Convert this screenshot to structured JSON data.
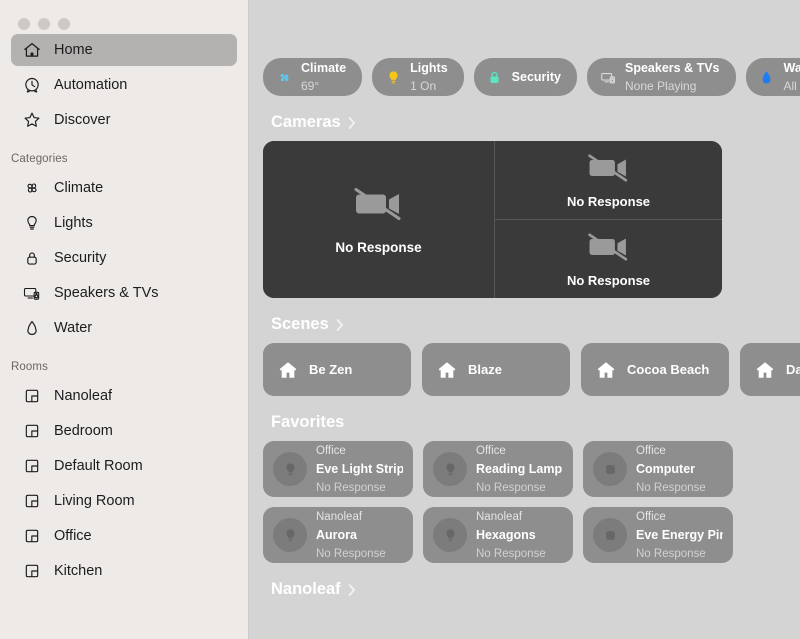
{
  "window": {
    "traffic_lights": [
      "close",
      "minimize",
      "zoom"
    ]
  },
  "sidebar": {
    "nav": [
      {
        "label": "Home",
        "icon": "house-icon",
        "selected": true
      },
      {
        "label": "Automation",
        "icon": "clock-arrow-icon",
        "selected": false
      },
      {
        "label": "Discover",
        "icon": "star-icon",
        "selected": false
      }
    ],
    "categories_header": "Categories",
    "categories": [
      {
        "label": "Climate",
        "icon": "fan-icon"
      },
      {
        "label": "Lights",
        "icon": "lightbulb-icon"
      },
      {
        "label": "Security",
        "icon": "lock-icon"
      },
      {
        "label": "Speakers & TVs",
        "icon": "tv-speaker-icon"
      },
      {
        "label": "Water",
        "icon": "drop-icon"
      }
    ],
    "rooms_header": "Rooms",
    "rooms": [
      {
        "label": "Nanoleaf",
        "icon": "room-icon"
      },
      {
        "label": "Bedroom",
        "icon": "room-icon"
      },
      {
        "label": "Default Room",
        "icon": "room-icon"
      },
      {
        "label": "Living Room",
        "icon": "room-icon"
      },
      {
        "label": "Office",
        "icon": "room-icon"
      },
      {
        "label": "Kitchen",
        "icon": "room-icon"
      }
    ]
  },
  "status_pills": [
    {
      "title": "Climate",
      "subtitle": "69°",
      "icon": "fan-icon",
      "color": "#5ac8f5"
    },
    {
      "title": "Lights",
      "subtitle": "1 On",
      "icon": "lightbulb-icon",
      "color": "#f5c518"
    },
    {
      "title": "Security",
      "subtitle": "",
      "icon": "lock-icon",
      "color": "#5fe3c0"
    },
    {
      "title": "Speakers & TVs",
      "subtitle": "None Playing",
      "icon": "tv-speaker-icon",
      "color": "#d9d9d9"
    },
    {
      "title": "Water",
      "subtitle": "All Off",
      "icon": "drop-icon",
      "color": "#1d7df5"
    }
  ],
  "sections": {
    "cameras": {
      "title": "Cameras",
      "has_chevron": true
    },
    "scenes": {
      "title": "Scenes",
      "has_chevron": true
    },
    "favorites": {
      "title": "Favorites",
      "has_chevron": false
    },
    "nanoleaf": {
      "title": "Nanoleaf",
      "has_chevron": true
    }
  },
  "cameras": {
    "large": {
      "status": "No Response",
      "icon": "video-off-icon"
    },
    "small": [
      {
        "status": "No Response",
        "icon": "video-off-icon"
      },
      {
        "status": "No Response",
        "icon": "video-off-icon"
      }
    ]
  },
  "scenes": [
    {
      "name": "Be Zen",
      "icon": "house-filled-icon"
    },
    {
      "name": "Blaze",
      "icon": "house-filled-icon"
    },
    {
      "name": "Cocoa Beach",
      "icon": "house-filled-icon"
    },
    {
      "name": "Date Ni",
      "icon": "house-filled-icon"
    }
  ],
  "favorites": [
    [
      {
        "room": "Office",
        "name": "Eve Light Strip",
        "state": "No Response",
        "icon": "lightbulb-icon"
      },
      {
        "room": "Office",
        "name": "Reading Lamp",
        "state": "No Response",
        "icon": "lightbulb-icon"
      },
      {
        "room": "Office",
        "name": "Computer",
        "state": "No Response",
        "icon": "outlet-icon"
      }
    ],
    [
      {
        "room": "Nanoleaf",
        "name": "Aurora",
        "state": "No Response",
        "icon": "lightbulb-icon"
      },
      {
        "room": "Nanoleaf",
        "name": "Hexagons",
        "state": "No Response",
        "icon": "lightbulb-icon"
      },
      {
        "room": "Office",
        "name": "Eve Energy Pin...",
        "state": "No Response",
        "icon": "outlet-icon"
      }
    ]
  ],
  "colors": {
    "sidebar_bg": "#eeeae7",
    "main_bg": "#d4d4d4",
    "tile_bg": "#8e8e8e",
    "camera_bg": "#3a3a3a",
    "selected_bg": "#b4b2b0",
    "header_text": "#ffffff"
  }
}
